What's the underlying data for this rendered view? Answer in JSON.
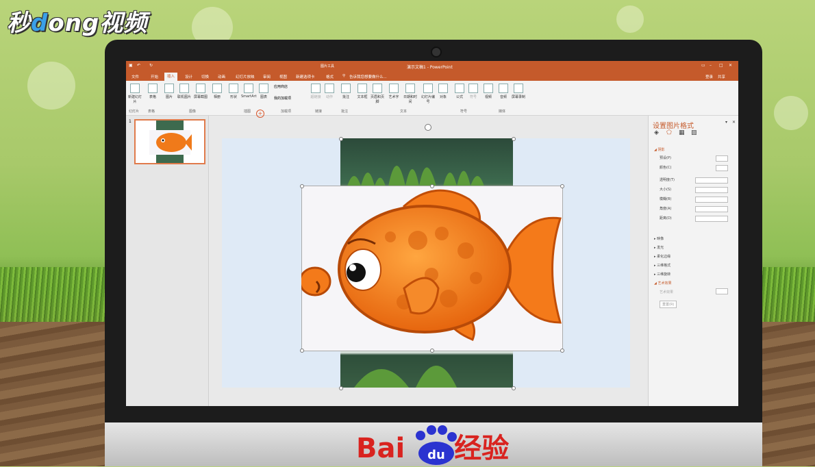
{
  "logo": {
    "text_pre": "秒",
    "text_d": "d",
    "text_rest": "ong视频"
  },
  "app": {
    "title": "演示文稿1 - PowerPoint",
    "picture_tools": "图片工具",
    "tell_me": "告诉我您想要做什么...",
    "login": "登录",
    "share": "共享",
    "tabs": [
      "文件",
      "开始",
      "插入",
      "设计",
      "切换",
      "动画",
      "幻灯片放映",
      "审阅",
      "视图",
      "新建选项卡",
      "格式"
    ],
    "active_tab": "插入",
    "ribbon_buttons": [
      "新建幻灯片",
      "表格",
      "图片",
      "联机图片",
      "屏幕截图",
      "相册",
      "形状",
      "SmartArt",
      "图表",
      "应用商店",
      "我的加载项",
      "超链接",
      "动作",
      "批注",
      "文本框",
      "页眉和页脚",
      "艺术字",
      "日期和时间",
      "幻灯片编号",
      "对象",
      "公式",
      "符号",
      "视频",
      "音频",
      "屏幕录制"
    ],
    "ribbon_groups": [
      "幻灯片",
      "表格",
      "图像",
      "插图",
      "加载项",
      "链接",
      "批注",
      "文本",
      "符号",
      "媒体"
    ],
    "slide_number": "1"
  },
  "format_panel": {
    "title": "设置图片格式",
    "section_shadow": "阴影",
    "rows": [
      "预设(P)",
      "颜色(C)",
      "透明度(T)",
      "大小(S)",
      "模糊(B)",
      "角度(A)",
      "距离(D)"
    ],
    "sections": [
      "映像",
      "发光",
      "柔化边缘",
      "三维格式",
      "三维旋转",
      "艺术效果"
    ],
    "art_label": "艺术效果",
    "reset": "重置(R)"
  },
  "brand": {
    "baidu": "Bai",
    "du": "du",
    "jingyan": "经验"
  }
}
